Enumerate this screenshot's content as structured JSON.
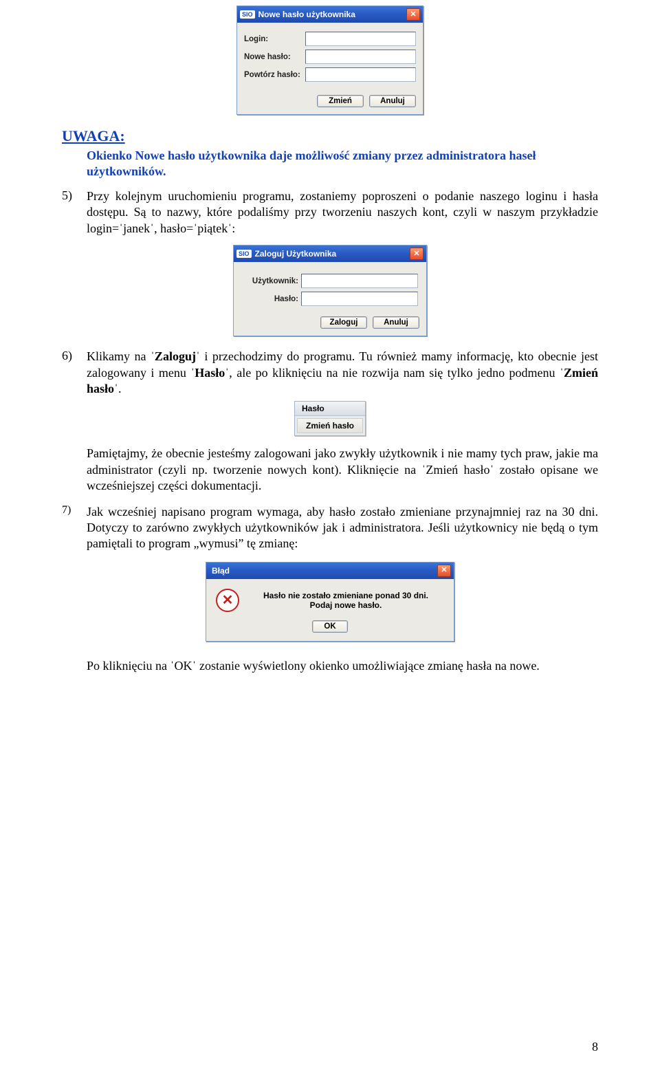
{
  "dialog1": {
    "sio": "SIO",
    "title": "Nowe hasło użytkownika",
    "fields": {
      "login": "Login:",
      "newpass": "Nowe hasło:",
      "repeat": "Powtórz hasło:"
    },
    "btn_change": "Zmień",
    "btn_cancel": "Anuluj"
  },
  "uwaga_heading": "UWAGA:",
  "uwaga_text": "Okienko Nowe hasło użytkownika daje możliwość zmiany przez administratora haseł użytkowników.",
  "item5_num": "5)",
  "item5_text": "Przy kolejnym uruchomieniu programu, zostaniemy poproszeni o podanie naszego loginu i hasła dostępu. Są to nazwy, które podaliśmy przy tworzeniu naszych kont, czyli w naszym przykładzie login=ˈjanekˈ, hasło=ˈpiątekˈ:",
  "dialog2": {
    "sio": "SIO",
    "title": "Zaloguj Użytkownika",
    "fields": {
      "user": "Użytkownik:",
      "pass": "Hasło:"
    },
    "btn_login": "Zaloguj",
    "btn_cancel": "Anuluj"
  },
  "item6_num": "6)",
  "item6_text_a": "Klikamy na ",
  "item6_text_b": "ˈZalogujˈ",
  "item6_text_c": " i przechodzimy do programu. Tu również mamy informację, kto obecnie jest zalogowany i menu ",
  "item6_text_d": "ˈHasłoˈ",
  "item6_text_e": ", ale po kliknięciu na nie rozwija nam się tylko jedno podmenu ",
  "item6_text_f": "ˈZmień hasłoˈ",
  "item6_text_g": ".",
  "menu": {
    "head": "Hasło",
    "item": "Zmień hasło"
  },
  "para6b": "Pamiętajmy, że obecnie jesteśmy zalogowani jako zwykły użytkownik i nie mamy tych praw, jakie ma administrator (czyli np. tworzenie nowych kont). Kliknięcie na ˈZmień hasłoˈ zostało opisane we wcześniejszej części dokumentacji.",
  "item7_num": "7)",
  "item7_text": "Jak wcześniej napisano program wymaga, aby hasło zostało zmieniane przynajmniej raz na 30 dni. Dotyczy to zarówno zwykłych użytkowników jak i administratora. Jeśli użytkownicy nie będą o tym pamiętali to program „wymusi” tę zmianę:",
  "error_dialog": {
    "title": "Błąd",
    "line1": "Hasło nie zostało zmieniane ponad 30 dni.",
    "line2": "Podaj nowe hasło.",
    "btn_ok": "OK"
  },
  "final_para": "Po kliknięciu na ˈOKˈ zostanie wyświetlony okienko umożliwiające zmianę hasła na nowe.",
  "page_number": "8"
}
